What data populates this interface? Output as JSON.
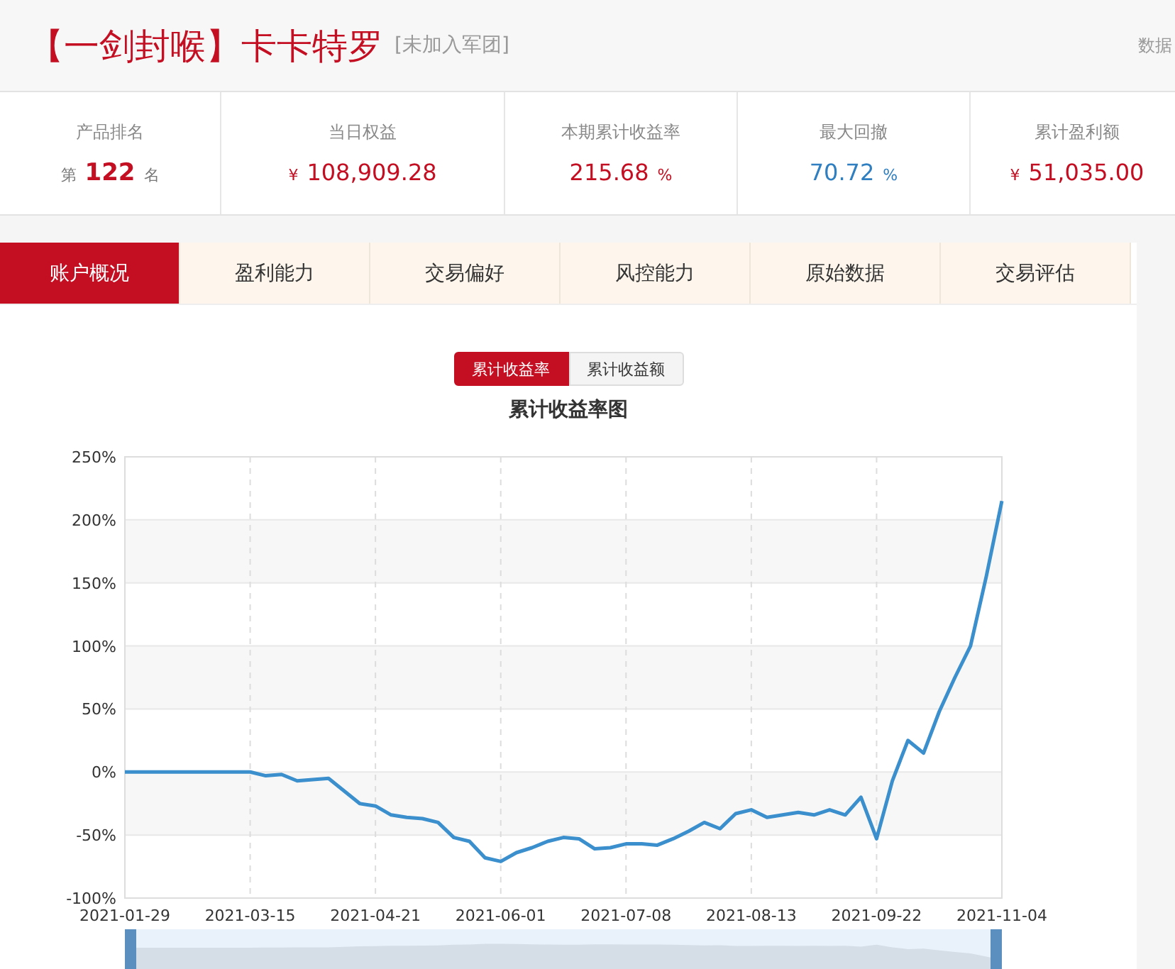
{
  "header": {
    "title": "【一剑封喉】卡卡特罗",
    "subtitle": "[未加入军团]",
    "right_text": "数据"
  },
  "stats": [
    {
      "kind": "rank",
      "label": "产品排名",
      "prefix": "第",
      "value": "122",
      "unit": "名",
      "color": "#c40f23"
    },
    {
      "kind": "amount",
      "label": "当日权益",
      "prefix": "¥",
      "value": "108,909.28",
      "color": "#c40f23"
    },
    {
      "kind": "amount",
      "label": "本期累计收益率",
      "value": "215.68",
      "unit": "%",
      "color": "#c40f23"
    },
    {
      "kind": "amount",
      "label": "最大回撤",
      "value": "70.72",
      "unit": "%",
      "color": "#2f7fc1"
    },
    {
      "kind": "amount",
      "label": "累计盈利额",
      "prefix": "¥",
      "value": "51,035.00",
      "color": "#c40f23"
    }
  ],
  "tabs": [
    {
      "label": "账户概况",
      "selected": true
    },
    {
      "label": "盈利能力",
      "selected": false
    },
    {
      "label": "交易偏好",
      "selected": false
    },
    {
      "label": "风控能力",
      "selected": false
    },
    {
      "label": "原始数据",
      "selected": false
    },
    {
      "label": "交易评估",
      "selected": false
    }
  ],
  "chart_switch": [
    {
      "label": "累计收益率",
      "selected": true
    },
    {
      "label": "累计收益额",
      "selected": false
    }
  ],
  "chart": {
    "chart_data": {
      "type": "line",
      "title": "累计收益率图",
      "categories": [
        "2021-01-29",
        null,
        null,
        null,
        null,
        null,
        null,
        null,
        "2021-03-15",
        null,
        null,
        null,
        null,
        null,
        null,
        null,
        "2021-04-21",
        null,
        null,
        null,
        null,
        null,
        null,
        null,
        "2021-06-01",
        null,
        null,
        null,
        null,
        null,
        null,
        null,
        "2021-07-08",
        null,
        null,
        null,
        null,
        null,
        null,
        null,
        "2021-08-13",
        null,
        null,
        null,
        null,
        null,
        null,
        null,
        "2021-09-22",
        null,
        null,
        null,
        null,
        null,
        null,
        null,
        "2021-11-04"
      ],
      "series": [
        {
          "color": "#3a8fcc",
          "values": [
            0,
            0,
            0,
            0,
            0,
            0,
            0,
            0,
            0,
            -3,
            -2,
            -7,
            -6,
            -5,
            -15,
            -25,
            -27,
            -34,
            -36,
            -37,
            -40,
            -52,
            -55,
            -68,
            -71,
            -64,
            -60,
            -55,
            -52,
            -53,
            -61,
            -60,
            -57,
            -57,
            -58,
            -53,
            -47,
            -40,
            -45,
            -33,
            -30,
            -36,
            -34,
            -32,
            -34,
            -30,
            -34,
            -20,
            -53,
            -7,
            25,
            15,
            48,
            75,
            100,
            155,
            215
          ]
        }
      ],
      "yticks": [
        {
          "value": 250,
          "label": "250%"
        },
        {
          "value": 200,
          "label": "200%"
        },
        {
          "value": 150,
          "label": "150%"
        },
        {
          "value": 100,
          "label": "100%"
        },
        {
          "value": 50,
          "label": "50%"
        },
        {
          "value": 0,
          "label": "0%"
        },
        {
          "value": -50,
          "label": "-50%"
        },
        {
          "value": -100,
          "label": "-100%"
        }
      ],
      "ylim": [
        -100,
        250
      ],
      "grid": true
    }
  }
}
